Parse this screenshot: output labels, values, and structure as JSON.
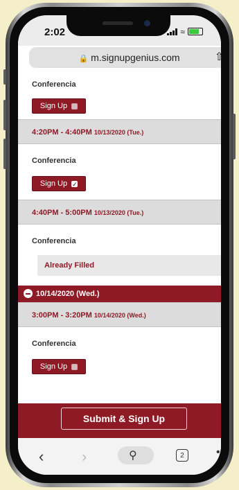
{
  "status": {
    "time": "2:02"
  },
  "browser": {
    "url": "m.signupgenius.com",
    "tab_count": "2"
  },
  "rows": {
    "top_label": "Conferencia",
    "signup_label": "Sign Up",
    "slot1": {
      "time": "4:20PM - 4:40PM",
      "date": "10/13/2020 (Tue.)",
      "label": "Conferencia"
    },
    "slot2": {
      "time": "4:40PM - 5:00PM",
      "date": "10/13/2020 (Tue.)",
      "label": "Conferencia",
      "filled": "Already Filled"
    },
    "day": {
      "text": "10/14/2020 (Wed.)"
    },
    "slot3": {
      "time": "3:00PM - 3:20PM",
      "date": "10/14/2020 (Wed.)",
      "label": "Conferencia"
    }
  },
  "submit": {
    "label": "Submit & Sign Up"
  },
  "colors": {
    "brand": "#8e1a26",
    "slot_bg": "#dcdcdc",
    "toolbar": "#f3f3f3"
  },
  "icons": [
    "lock-icon",
    "share-icon",
    "back-icon",
    "forward-icon",
    "search-icon",
    "tabs-icon",
    "more-icon",
    "minus-circle-icon",
    "checkbox-icon"
  ]
}
